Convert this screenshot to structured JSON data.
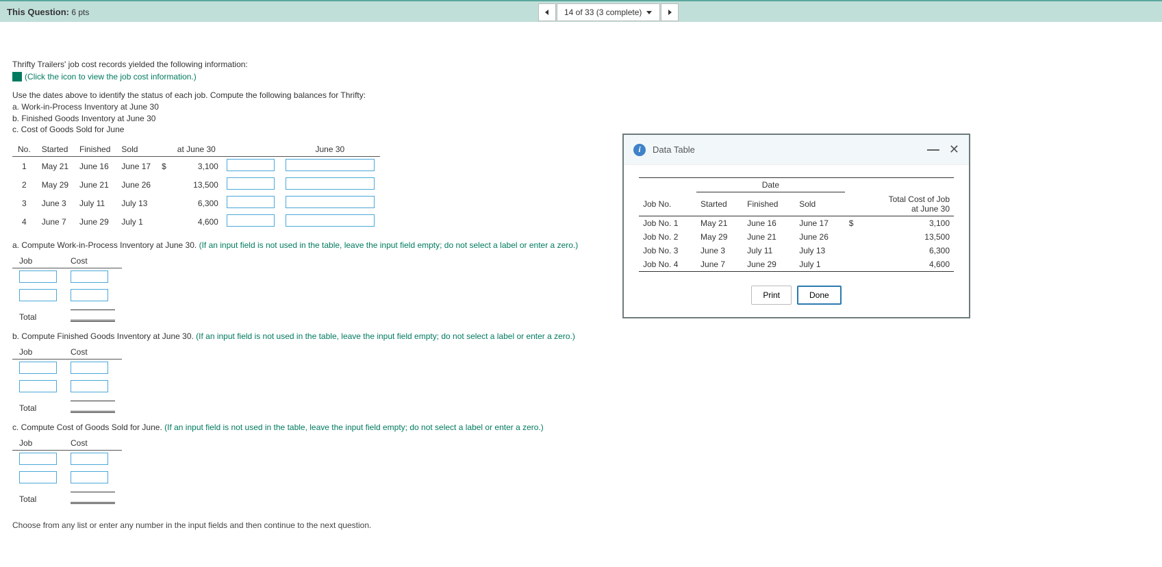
{
  "header": {
    "title_label": "This Question:",
    "pts": "6 pts",
    "nav_status": "14 of 33 (3 complete)"
  },
  "intro": "Thrifty Trailers' job cost records yielded the following information:",
  "link_text": "(Click the icon to view the job cost information.)",
  "instructions": {
    "lead": "Use the dates above to identify the status of each job. Compute the following balances for Thrifty:",
    "a": "a. Work-in-Process Inventory at June 30",
    "b": "b. Finished Goods Inventory at June 30",
    "c": "c. Cost of Goods Sold for June"
  },
  "table_headers": {
    "no": "No.",
    "started": "Started",
    "finished": "Finished",
    "sold": "Sold",
    "at_june30": "at June 30",
    "june30": "June 30"
  },
  "main_rows": [
    {
      "no": "1",
      "started": "May 21",
      "finished": "June 16",
      "sold": "June 17",
      "dollar": "$",
      "amount": "3,100"
    },
    {
      "no": "2",
      "started": "May 29",
      "finished": "June 21",
      "sold": "June 26",
      "dollar": "",
      "amount": "13,500"
    },
    {
      "no": "3",
      "started": "June 3",
      "finished": "July 11",
      "sold": "July 13",
      "dollar": "",
      "amount": "6,300"
    },
    {
      "no": "4",
      "started": "June 7",
      "finished": "June 29",
      "sold": "July 1",
      "dollar": "",
      "amount": "4,600"
    }
  ],
  "prompts": {
    "a_main": "a. Compute Work-in-Process Inventory at June 30. ",
    "b_main": "b. Compute Finished Goods Inventory at June 30. ",
    "c_main": "c. Compute Cost of Goods Sold for June. ",
    "hint": "(If an input field is not used in the table, leave the input field empty; do not select a label or enter a zero.)"
  },
  "mini_headers": {
    "job": "Job",
    "cost": "Cost"
  },
  "total_label": "Total",
  "footer": "Choose from any list or enter any number in the input fields and then continue to the next question.",
  "modal": {
    "title": "Data Table",
    "date_label": "Date",
    "headers": {
      "jobno": "Job No.",
      "started": "Started",
      "finished": "Finished",
      "sold": "Sold",
      "totalcost_l1": "Total Cost of Job",
      "totalcost_l2": "at June 30"
    },
    "rows": [
      {
        "job": "Job No. 1",
        "started": "May 21",
        "finished": "June 16",
        "sold": "June 17",
        "dollar": "$",
        "cost": "3,100"
      },
      {
        "job": "Job No. 2",
        "started": "May 29",
        "finished": "June 21",
        "sold": "June 26",
        "dollar": "",
        "cost": "13,500"
      },
      {
        "job": "Job No. 3",
        "started": "June 3",
        "finished": "July 11",
        "sold": "July 13",
        "dollar": "",
        "cost": "6,300"
      },
      {
        "job": "Job No. 4",
        "started": "June 7",
        "finished": "June 29",
        "sold": "July 1",
        "dollar": "",
        "cost": "4,600"
      }
    ],
    "print": "Print",
    "done": "Done"
  }
}
